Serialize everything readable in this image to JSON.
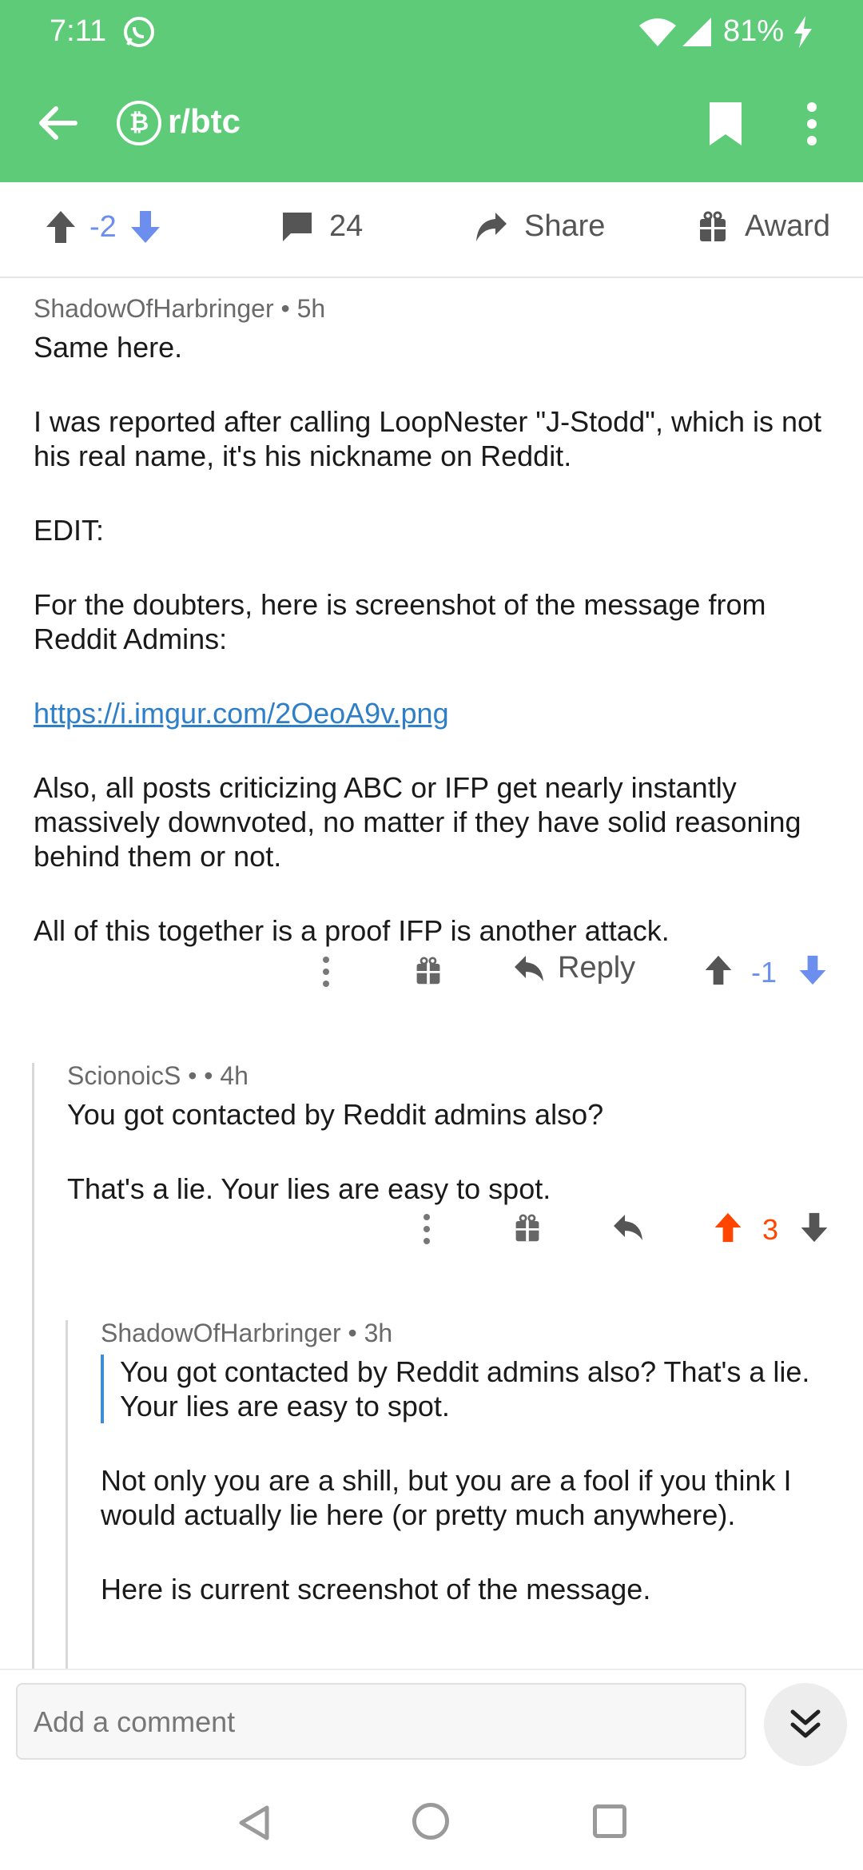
{
  "status_bar": {
    "time": "7:11",
    "battery": "81%"
  },
  "app_bar": {
    "subreddit_icon": "bitcoin-icon",
    "title": "r/btc"
  },
  "action_bar": {
    "score": "-2",
    "comment_count": "24",
    "share_label": "Share",
    "award_label": "Award"
  },
  "comments": [
    {
      "author": "ShadowOfHarbringer",
      "time": "5h",
      "paragraphs": [
        "Same here.",
        "I was reported after calling LoopNester \"J-Stodd\", which is not his real name, it's his nickname on Reddit.",
        "EDIT:",
        "For the doubters, here is screenshot of the message from Reddit Admins:",
        "https://i.imgur.com/2OeoA9v.png",
        "Also, all posts criticizing ABC or IFP get nearly instantly massively downvoted, no matter if they have solid reasoning behind them or not.",
        "All of this together is a proof IFP is another attack."
      ],
      "reply_label": "Reply",
      "score": "-1"
    },
    {
      "author": "ScionoicS",
      "time": "4h",
      "paragraphs": [
        "You got contacted by Reddit admins also?",
        "That's a lie.  Your lies are easy to spot."
      ],
      "score": "3"
    },
    {
      "author": "ShadowOfHarbringer",
      "time": "3h",
      "quote": "You got contacted by Reddit admins also? That's a lie. Your lies are easy to spot.",
      "paragraphs": [
        "Not only you are a shill, but you are a fool if you think I would actually lie here (or pretty much anywhere).",
        "Here is current screenshot of the message."
      ]
    }
  ],
  "comment_input": {
    "placeholder": "Add a comment"
  },
  "colors": {
    "header_green": "#5ecb78",
    "upvote_orange": "#ff4500",
    "vote_blue": "#6c8fef",
    "link_blue": "#2e7fc7"
  }
}
